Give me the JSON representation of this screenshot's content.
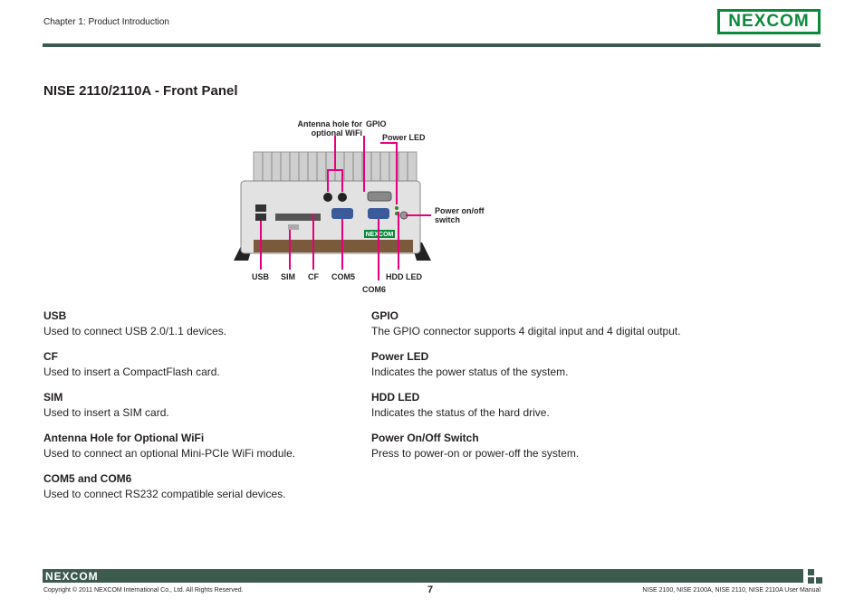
{
  "header": {
    "chapter": "Chapter 1: Product Introduction",
    "logo_text": "NEXCOM"
  },
  "title": "NISE 2110/2110A - Front Panel",
  "figure": {
    "badge": "NEXCOM",
    "labels": {
      "antenna": "Antenna hole for optional WiFi",
      "gpio": "GPIO",
      "power_led": "Power LED",
      "power_switch": "Power on/off switch",
      "usb": "USB",
      "sim": "SIM",
      "cf": "CF",
      "com5": "COM5",
      "hdd_led": "HDD LED",
      "com6": "COM6"
    }
  },
  "left_items": [
    {
      "title": "USB",
      "desc": "Used to connect USB 2.0/1.1 devices."
    },
    {
      "title": "CF",
      "desc": "Used to insert a CompactFlash card."
    },
    {
      "title": "SIM",
      "desc": "Used to insert a SIM card."
    },
    {
      "title": "Antenna Hole for Optional WiFi",
      "desc": "Used to connect an optional Mini-PCIe WiFi module."
    },
    {
      "title": "COM5 and COM6",
      "desc": "Used to connect RS232 compatible serial devices."
    }
  ],
  "right_items": [
    {
      "title": "GPIO",
      "desc": "The GPIO connector supports 4 digital input and 4 digital output."
    },
    {
      "title": "Power LED",
      "desc": "Indicates the power status of the system."
    },
    {
      "title": "HDD LED",
      "desc": "Indicates the status of the hard drive."
    },
    {
      "title": "Power On/Off Switch",
      "desc": "Press to power-on or power-off the system."
    }
  ],
  "footer": {
    "logo_text": "NEXCOM",
    "copyright": "Copyright © 2011 NEXCOM International Co., Ltd. All Rights Reserved.",
    "page": "7",
    "manual": "NISE 2100, NISE 2100A, NISE 2110, NISE 2110A User Manual"
  }
}
